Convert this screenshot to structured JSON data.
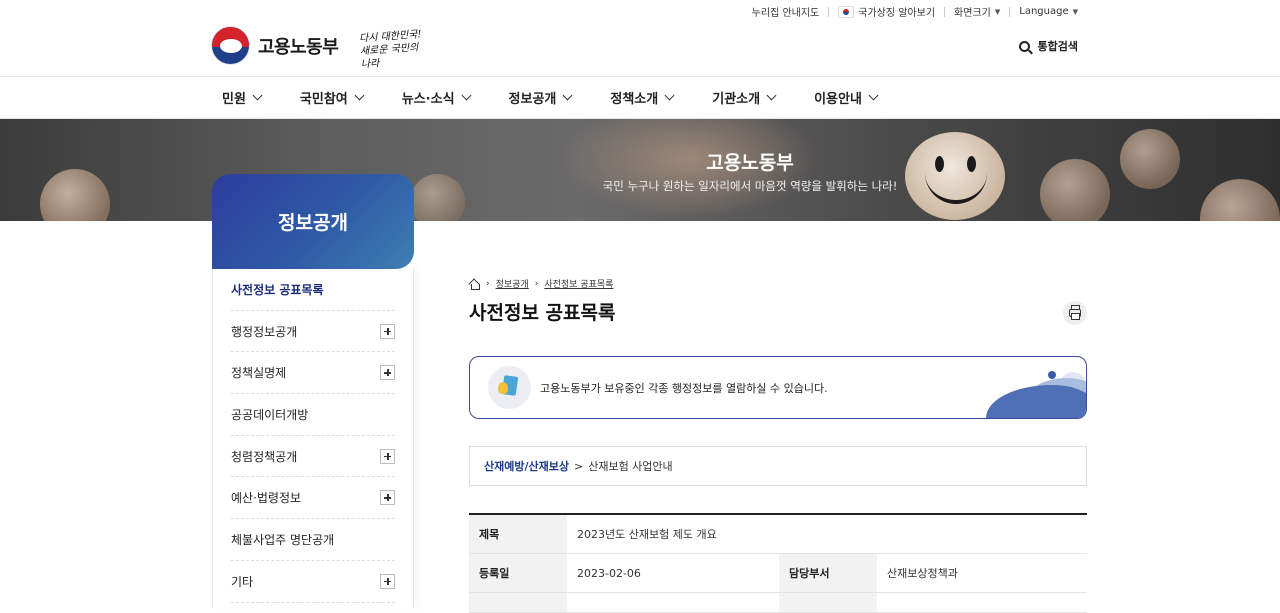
{
  "utility": {
    "sitemap": "누리집 안내지도",
    "symbol": "국가상징 알아보기",
    "screen_size": "화면크기",
    "language": "Language"
  },
  "header": {
    "logo_text": "고용노동부",
    "slogan_line1": "다시 대한민국!",
    "slogan_line2": "새로운 국민의 나라",
    "search_label": "통합검색"
  },
  "gnb": {
    "items": [
      {
        "label": "민원"
      },
      {
        "label": "국민참여"
      },
      {
        "label": "뉴스·소식"
      },
      {
        "label": "정보공개"
      },
      {
        "label": "정책소개"
      },
      {
        "label": "기관소개"
      },
      {
        "label": "이용안내"
      }
    ]
  },
  "banner": {
    "title": "고용노동부",
    "subtitle": "국민 누구나 원하는 일자리에서 마음껏 역량을 발휘하는 나라!"
  },
  "sidebar": {
    "title": "정보공개",
    "items": [
      {
        "label": "사전정보 공표목록"
      },
      {
        "label": "행정정보공개"
      },
      {
        "label": "정책실명제"
      },
      {
        "label": "공공데이터개방"
      },
      {
        "label": "청렴정책공개"
      },
      {
        "label": "예산·법령정보"
      },
      {
        "label": "체불사업주 명단공개"
      },
      {
        "label": "기타"
      }
    ]
  },
  "breadcrumb": {
    "level1": "정보공개",
    "level2": "사전정보 공표목록",
    "separator": "›"
  },
  "page": {
    "title": "사전정보 공표목록",
    "info_text": "고용노동부가 보유중인 각종 행정정보를 열람하실 수 있습니다.",
    "category_primary": "산재예방/산재보상",
    "category_separator": ">",
    "category_secondary": "산재보험 사업안내"
  },
  "detail": {
    "title_label": "제목",
    "title_value": "2023년도 산재보험 제도 개요",
    "date_label": "등록일",
    "date_value": "2023-02-06",
    "dept_label": "담당부서",
    "dept_value": "산재보상정책과"
  },
  "colors": {
    "accent": "#2d3d9c",
    "accent_light": "#3f7fb3",
    "banner_dark": "#3b3b3b"
  },
  "icons": {
    "search": "search-icon",
    "print": "print-icon",
    "home": "home-icon"
  }
}
